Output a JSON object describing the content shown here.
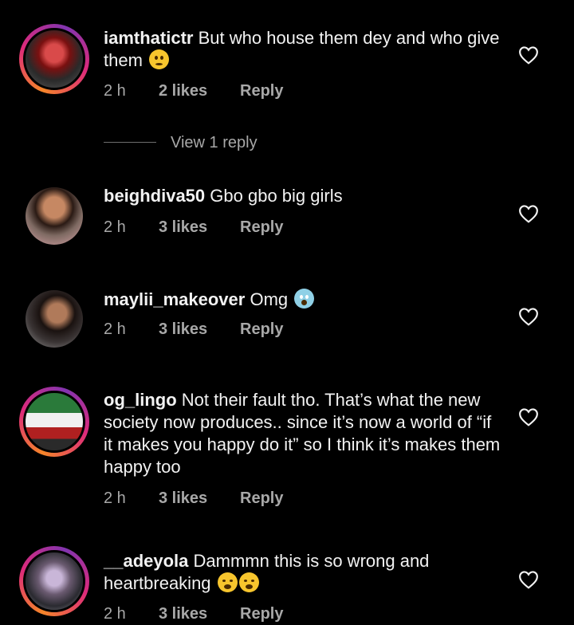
{
  "comments": [
    {
      "username": "iamthatictr",
      "text": "But who house them dey and who give them",
      "emoji": "thinking-face",
      "time": "2 h",
      "likes": "2 likes",
      "reply": "Reply",
      "view_replies": "View 1 reply"
    },
    {
      "username": "beighdiva50",
      "text": "Gbo gbo big girls",
      "time": "2 h",
      "likes": "3 likes",
      "reply": "Reply"
    },
    {
      "username": "maylii_makeover",
      "text": "Omg",
      "emoji": "face-screaming-in-fear",
      "time": "2 h",
      "likes": "3 likes",
      "reply": "Reply"
    },
    {
      "username": "og_lingo",
      "text": "Not their fault tho. That’s what the new society now produces.. since it’s now a world of “if it makes you happy do it” so I think it’s makes them happy too",
      "time": "2 h",
      "likes": "3 likes",
      "reply": "Reply"
    },
    {
      "username": "__adeyola",
      "text": "Dammmn this is so wrong and heartbreaking",
      "emoji": "weary-face weary-face",
      "time": "2 h",
      "likes": "3 likes",
      "reply": "Reply"
    }
  ],
  "icons": {
    "like": "heart-outline-icon"
  },
  "colors": {
    "background": "#000000",
    "text": "#f2f2f2",
    "meta": "#a8a8a8",
    "story_ring_start": "#f58529",
    "story_ring_mid": "#dd2a7b"
  }
}
